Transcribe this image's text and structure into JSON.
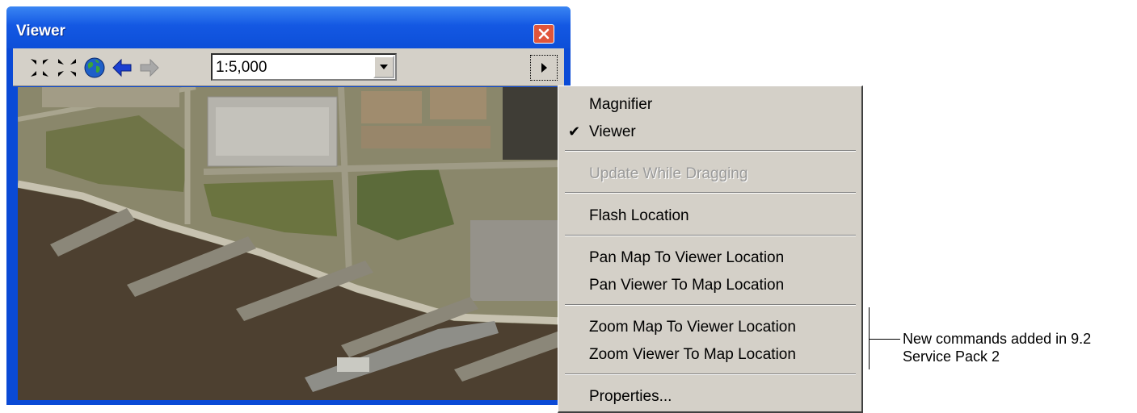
{
  "window": {
    "title": "Viewer",
    "close_icon": "close-icon",
    "colors": {
      "titlebar": "#1458e3",
      "close": "#e0553a"
    }
  },
  "toolbar": {
    "buttons": [
      {
        "name": "fixed-zoom-in",
        "icon": "fixed-zoom-in-icon"
      },
      {
        "name": "fixed-zoom-out",
        "icon": "fixed-zoom-out-icon"
      },
      {
        "name": "full-extent",
        "icon": "globe-icon"
      },
      {
        "name": "go-back",
        "icon": "back-arrow-icon"
      },
      {
        "name": "go-forward",
        "icon": "forward-arrow-icon",
        "enabled": false
      }
    ],
    "scale_value": "1:5,000",
    "menu_button_icon": "triangle-right-icon"
  },
  "viewport": {
    "content": "aerial-imagery"
  },
  "context_menu": {
    "items": [
      {
        "label": "Magnifier",
        "checked": false,
        "enabled": true
      },
      {
        "label": "Viewer",
        "checked": true,
        "enabled": true
      },
      {
        "label": "Update While Dragging",
        "checked": false,
        "enabled": false
      },
      {
        "label": "Flash Location",
        "checked": false,
        "enabled": true
      },
      {
        "label": "Pan Map To Viewer Location",
        "checked": false,
        "enabled": true
      },
      {
        "label": "Pan Viewer To Map Location",
        "checked": false,
        "enabled": true
      },
      {
        "label": "Zoom Map To Viewer Location",
        "checked": false,
        "enabled": true
      },
      {
        "label": "Zoom Viewer To Map Location",
        "checked": false,
        "enabled": true
      },
      {
        "label": "Properties...",
        "checked": false,
        "enabled": true
      }
    ],
    "check_mark": "✔"
  },
  "annotation": {
    "line1": "New commands added in 9.2",
    "line2": "Service Pack 2"
  }
}
